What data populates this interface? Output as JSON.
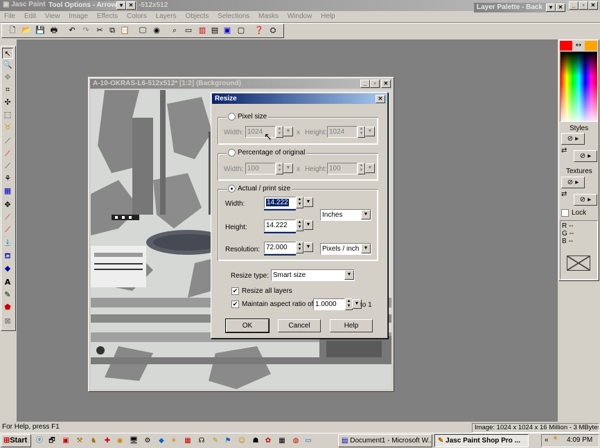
{
  "app": {
    "title": "Jasc Paint",
    "title_suffix": "-512x512"
  },
  "menu": [
    "File",
    "Edit",
    "View",
    "Image",
    "Effects",
    "Colors",
    "Layers",
    "Objects",
    "Selections",
    "Masks",
    "Window",
    "Help"
  ],
  "tool_options": {
    "title": "Tool Options - Arrow"
  },
  "layer_palette": {
    "title": "Layer Palette - Back"
  },
  "toolbar_icons": [
    "new-icon",
    "open-icon",
    "save-icon",
    "print-icon",
    "undo-icon",
    "redo-icon",
    "cut-icon",
    "copy-icon",
    "paste-icon",
    "browse-icon",
    "full-screen-icon",
    "zoom-icon",
    "toolbar-toggle-icon",
    "color-palette-icon",
    "histogram-icon",
    "layer-palette-icon",
    "overview-icon",
    "help-icon",
    "script-icon"
  ],
  "tools": [
    "arrow",
    "zoom",
    "deform",
    "crop",
    "mover",
    "selection",
    "freehand",
    "dropper",
    "paintbrush",
    "clone",
    "color-replacer",
    "retouch",
    "scratch-remover",
    "eraser",
    "picture-tube",
    "airbrush",
    "flood-fill",
    "text",
    "draw",
    "preset-shapes",
    "object-selector"
  ],
  "document": {
    "title": "A-10-OKRAS-L6-512x512* [1:2] (Background)"
  },
  "dialog": {
    "title": "Resize",
    "pixel_size": {
      "label": "Pixel size",
      "width_label": "Width:",
      "width": "1024",
      "x": "x",
      "height_label": "Height:",
      "height": "1024"
    },
    "percentage": {
      "label": "Percentage of original",
      "width_label": "Width:",
      "width": "100",
      "x": "x",
      "height_label": "Height:",
      "height": "100"
    },
    "actual": {
      "label": "Actual / print size",
      "width_label": "Width:",
      "width": "14.222",
      "height_label": "Height:",
      "height": "14.222",
      "resolution_label": "Resolution:",
      "resolution": "72.000",
      "units": "Inches",
      "res_units": "Pixels / inch"
    },
    "resize_type_label": "Resize type:",
    "resize_type": "Smart size",
    "resize_all_layers": "Resize all layers",
    "maintain_aspect": "Maintain aspect ratio of:",
    "aspect_value": "1.0000",
    "to_one": "to 1",
    "ok": "OK",
    "cancel": "Cancel",
    "help": "Help"
  },
  "right_panel": {
    "styles": "Styles",
    "textures": "Textures",
    "lock": "Lock",
    "channels": [
      "R",
      "G",
      "B"
    ],
    "channel_values": [
      "--",
      "--",
      "--"
    ],
    "swap": "↔",
    "fg_color": "#ff0000",
    "bg_color": "#ffa500"
  },
  "status": {
    "help": "For Help, press F1",
    "image_info": "Image: 1024 x 1024 x 16 Million - 3 MBytes"
  },
  "taskbar": {
    "start": "Start",
    "tasks": [
      "Document1 - Microsoft W...",
      "Jasc Paint Shop Pro ..."
    ],
    "clock": "4:09 PM",
    "tray_arrow": "«"
  }
}
